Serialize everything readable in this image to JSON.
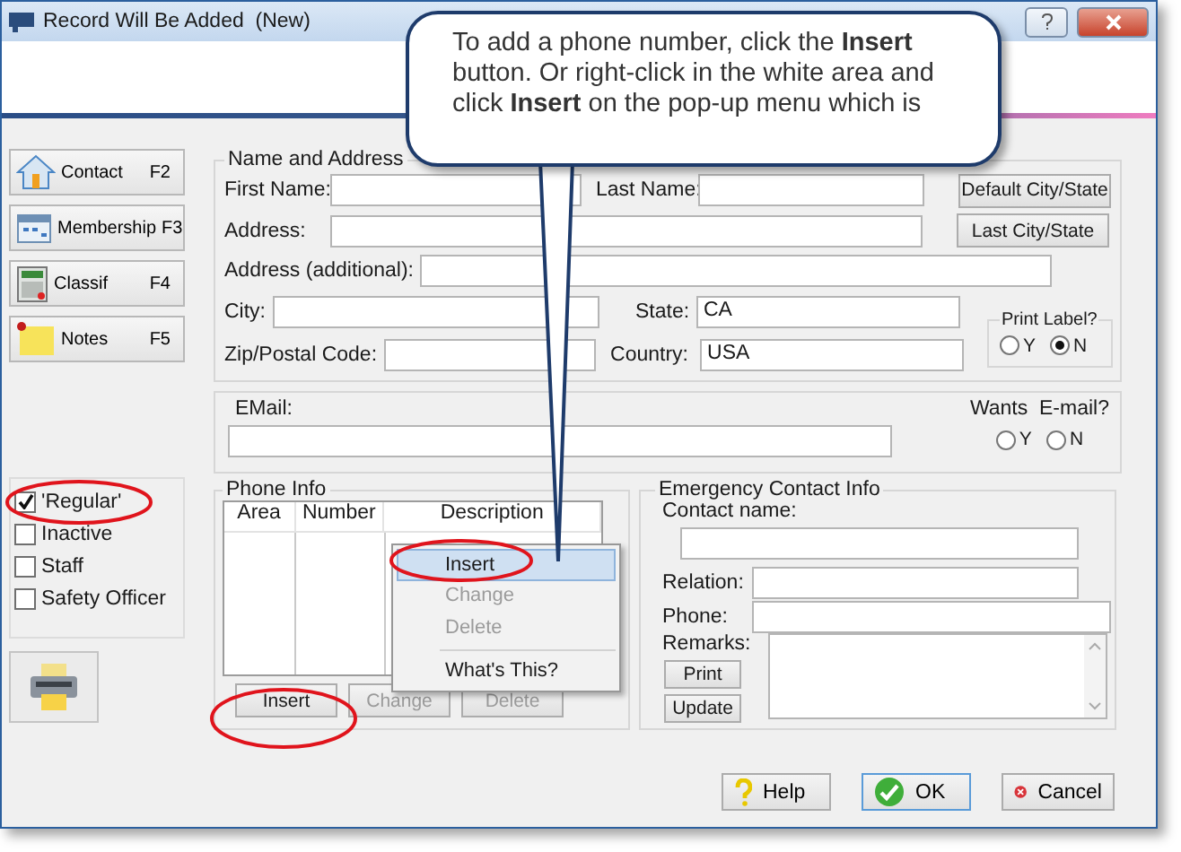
{
  "window": {
    "title": "Record Will Be Added  (New)"
  },
  "nav_buttons": [
    {
      "label": "Contact",
      "key": "F2",
      "kind": "house"
    },
    {
      "label": "Membership",
      "key": "F3",
      "kind": "calendar"
    },
    {
      "label": "Classif",
      "key": "F4",
      "kind": "calculator"
    },
    {
      "label": "Notes",
      "key": "F5",
      "kind": "note"
    }
  ],
  "status_checks": [
    {
      "label": "'Regular'",
      "checked": true
    },
    {
      "label": "Inactive",
      "checked": false
    },
    {
      "label": "Staff",
      "checked": false
    },
    {
      "label": "Safety Officer",
      "checked": false
    }
  ],
  "name_address": {
    "title": "Name and Address",
    "first_name": "First Name:",
    "last_name": "Last Name:",
    "address": "Address:",
    "address2": "Address (additional):",
    "city": "City:",
    "state": {
      "label": "State:",
      "value": "CA"
    },
    "zip": "Zip/Postal Code:",
    "country": {
      "label": "Country:",
      "value": "USA"
    },
    "buttons": [
      "Default City/State",
      "Last City/State"
    ],
    "print_label": {
      "title": "Print Label?",
      "options": [
        {
          "label": "Y",
          "selected": false
        },
        {
          "label": "N",
          "selected": true
        }
      ]
    }
  },
  "email": {
    "label": "EMail:",
    "wants_label": "Wants  E-mail?",
    "options": [
      {
        "label": "Y",
        "selected": false
      },
      {
        "label": "N",
        "selected": false
      }
    ]
  },
  "phone_info": {
    "title": "Phone Info",
    "columns": [
      "Area",
      "Number",
      "Description"
    ],
    "buttons": [
      {
        "label": "Insert",
        "disabled": false
      },
      {
        "label": "Change",
        "disabled": true
      },
      {
        "label": "Delete",
        "disabled": true
      }
    ],
    "context_menu": [
      {
        "label": "Insert",
        "selected": true,
        "disabled": false
      },
      {
        "label": "Change",
        "selected": false,
        "disabled": true
      },
      {
        "label": "Delete",
        "selected": false,
        "disabled": true
      },
      {
        "label": "What's This?",
        "selected": false,
        "disabled": false
      }
    ]
  },
  "emergency": {
    "title": "Emergency Contact Info",
    "contact_name": "Contact name:",
    "relation": "Relation:",
    "phone": "Phone:",
    "remarks": "Remarks:",
    "buttons": [
      "Print",
      "Update"
    ]
  },
  "footer_buttons": [
    {
      "label": "Help",
      "kind": "help"
    },
    {
      "label": "OK",
      "kind": "ok"
    },
    {
      "label": "Cancel",
      "kind": "cancel"
    }
  ],
  "callout": {
    "text": "To add a phone number, click the **Insert** button.  Or right-click in the white area and click **Insert** on the pop-up menu which is"
  }
}
